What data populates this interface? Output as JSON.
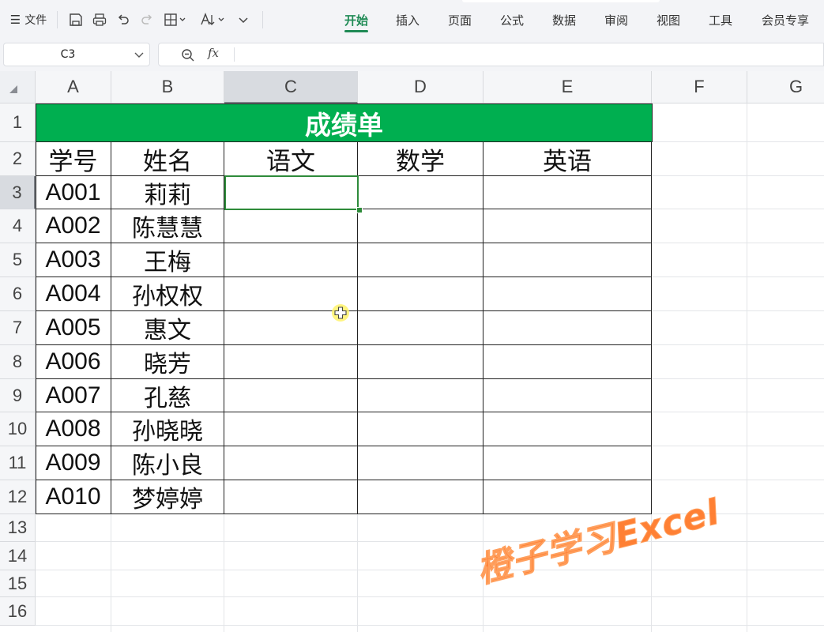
{
  "menubar": {
    "file_label": "文件",
    "tabs": [
      {
        "label": "开始",
        "active": true
      },
      {
        "label": "插入",
        "active": false
      },
      {
        "label": "页面",
        "active": false
      },
      {
        "label": "公式",
        "active": false
      },
      {
        "label": "数据",
        "active": false
      },
      {
        "label": "审阅",
        "active": false
      },
      {
        "label": "视图",
        "active": false
      },
      {
        "label": "工具",
        "active": false
      },
      {
        "label": "会员专享",
        "active": false
      }
    ],
    "accent_color": "#1f8a55"
  },
  "formula_bar": {
    "name_box": "C3",
    "fx_label": "fx",
    "formula": ""
  },
  "sheet": {
    "columns": [
      "A",
      "B",
      "C",
      "D",
      "E",
      "F",
      "G"
    ],
    "rows": [
      "1",
      "2",
      "3",
      "4",
      "5",
      "6",
      "7",
      "8",
      "9",
      "10",
      "11",
      "12",
      "13",
      "14",
      "15",
      "16"
    ],
    "selected_cell": "C3",
    "title": "成绩单",
    "title_fill": "#00af50",
    "headers": [
      "学号",
      "姓名",
      "语文",
      "数学",
      "英语"
    ],
    "records": [
      {
        "id": "A001",
        "name": "莉莉"
      },
      {
        "id": "A002",
        "name": "陈慧慧"
      },
      {
        "id": "A003",
        "name": "王梅"
      },
      {
        "id": "A004",
        "name": "孙权权"
      },
      {
        "id": "A005",
        "name": "惠文"
      },
      {
        "id": "A006",
        "name": "晓芳"
      },
      {
        "id": "A007",
        "name": "孔慈"
      },
      {
        "id": "A008",
        "name": "孙晓晓"
      },
      {
        "id": "A009",
        "name": "陈小良"
      },
      {
        "id": "A010",
        "name": "梦婷婷"
      }
    ]
  },
  "watermark": "橙子学习Excel"
}
